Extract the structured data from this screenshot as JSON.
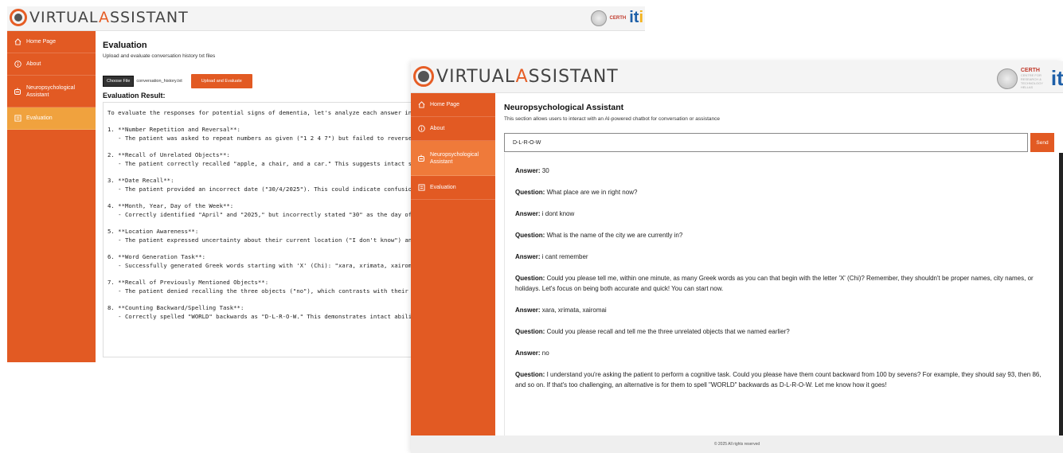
{
  "app": {
    "logo_first": "V",
    "logo_mid": "IRTUAL",
    "logo_accent": "A",
    "logo_rest": "SSISTANT",
    "certh_label": "CERTH",
    "certh_sub": "CENTRE FOR RESEARCH & TECHNOLOGY HELLAS",
    "iti_label": "it",
    "iti_dot": "i"
  },
  "window1": {
    "sidebar": [
      {
        "label": "Home Page",
        "icon": "home-icon"
      },
      {
        "label": "About",
        "icon": "info-icon"
      },
      {
        "label": "Neuropsychological Assistant",
        "icon": "chat-bot-icon"
      },
      {
        "label": "Evaluation",
        "icon": "evaluation-icon"
      }
    ],
    "title": "Evaluation",
    "subtitle": "Upload and evaluate conversation history txt files",
    "choose_file_label": "Choose File",
    "file_name": "conversation_history.txt",
    "upload_button": "Upload and Evaluate",
    "result_heading": "Evaluation Result:",
    "result_lines": [
      "To evaluate the responses for potential signs of dementia, let's analyze each answer in context:",
      "",
      "1. **Number Repetition and Reversal**:",
      "   - The patient was asked to repeat numbers as given (\"1 2 4 7\") but failed to reverse them whe",
      "",
      "2. **Recall of Unrelated Objects**:",
      "   - The patient correctly recalled \"apple, a chair, and a car.\" This suggests intact short-term recal",
      "",
      "3. **Date Recall**:",
      "   - The patient provided an incorrect date (\"30/4/2025\"). This could indicate confusion with time",
      "",
      "4. **Month, Year, Day of the Week**:",
      "   - Correctly identified \"April\" and \"2025,\" but incorrectly stated \"30\" as the day of the week, wh",
      "",
      "5. **Location Awareness**:",
      "   - The patient expressed uncertainty about their current location (\"I don't know\") and inability t",
      "",
      "6. **Word Generation Task**:",
      "   - Successfully generated Greek words starting with 'X' (Chi): \"xara, xrimata, xairomai.\" This in",
      "",
      "7. **Recall of Previously Mentioned Objects**:",
      "   - The patient denied recalling the three objects (\"no\"), which contrasts with their earlier correc",
      "",
      "8. **Counting Backward/Spelling Task**:",
      "   - Correctly spelled \"WORLD\" backwards as \"D-L-R-O-W.\" This demonstrates intact ability to foll"
    ]
  },
  "window2": {
    "sidebar": [
      {
        "label": "Home Page",
        "icon": "home-icon"
      },
      {
        "label": "About",
        "icon": "info-icon"
      },
      {
        "label": "Neuropsychological Assistant",
        "icon": "chat-bot-icon"
      },
      {
        "label": "Evaluation",
        "icon": "evaluation-icon"
      }
    ],
    "title": "Neuropsychological Assistant",
    "subtitle": "This section allows users to interact with an AI-powered chatbot for conversation or assistance",
    "input_value": "D-L-R-O-W",
    "send_button": "Send",
    "messages": [
      {
        "role": "Answer:",
        "text": "30"
      },
      {
        "role": "Question:",
        "text": "What place are we in right now?"
      },
      {
        "role": "Answer:",
        "text": "i dont know"
      },
      {
        "role": "Question:",
        "text": "What is the name of the city we are currently in?"
      },
      {
        "role": "Answer:",
        "text": "i cant remember"
      },
      {
        "role": "Question:",
        "text": "Could you please tell me, within one minute, as many Greek words as you can that begin with the letter 'X' (Chi)? Remember, they shouldn't be proper names, city names, or holidays. Let's focus on being both accurate and quick! You can start now."
      },
      {
        "role": "Answer:",
        "text": "xara, xrimata, xairomai"
      },
      {
        "role": "Question:",
        "text": "Could you please recall and tell me the three unrelated objects that we named earlier?"
      },
      {
        "role": "Answer:",
        "text": "no"
      },
      {
        "role": "Question:",
        "text": "I understand you're asking the patient to perform a cognitive task. Could you please have them count backward from 100 by sevens? For example, they should say 93, then 86, and so on. If that's too challenging, an alternative is for them to spell \"WORLD\" backwards as D-L-R-O-W. Let me know how it goes!"
      }
    ],
    "footer": "© 2025 All rights reserved"
  },
  "colors": {
    "sidebar": "#e25a23",
    "active_evaluation": "#f0a23e",
    "active_assistant": "#ef7a3a",
    "accent": "#e65d25"
  }
}
